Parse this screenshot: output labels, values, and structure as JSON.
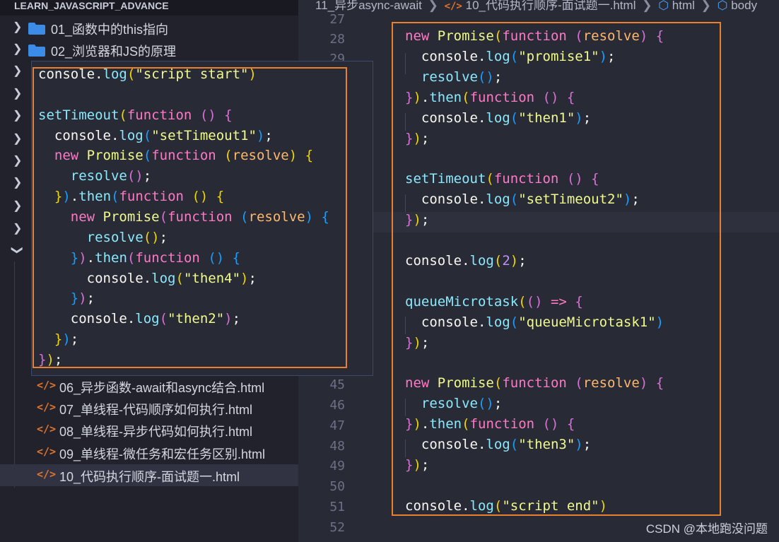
{
  "sidebar": {
    "header": "LEARN_JAVASCRIPT_ADVANCE",
    "folders": [
      {
        "label": "01_函数中的this指向"
      },
      {
        "label": "02_浏览器和JS的原理"
      }
    ],
    "files": [
      {
        "label": "06_异步函数-await和async结合.html"
      },
      {
        "label": "07_单线程-代码顺序如何执行.html"
      },
      {
        "label": "08_单线程-异步代码如何执行.html"
      },
      {
        "label": "09_单线程-微任务和宏任务区别.html"
      },
      {
        "label": "10_代码执行顺序-面试题一.html"
      }
    ],
    "file_icon": "html-tag-icon",
    "folder_icon": "folder-icon"
  },
  "breadcrumb": {
    "folder": "11_异步async-await",
    "file": "10_代码执行顺序-面试题一.html",
    "node1": "html",
    "node2": "body"
  },
  "gutter": {
    "lines": [
      "27",
      "28",
      "29",
      "45",
      "46",
      "47",
      "48",
      "49",
      "50",
      "51",
      "52"
    ]
  },
  "editor": {
    "lines": [
      "new Promise(function (resolve) {",
      "  console.log(\"promise1\");",
      "  resolve();",
      "}).then(function () {",
      "  console.log(\"then1\");",
      "});",
      "",
      "setTimeout(function () {",
      "  console.log(\"setTimeout2\");",
      "});",
      "",
      "console.log(2);",
      "",
      "queueMicrotask(() => {",
      "  console.log(\"queueMicrotask1\")",
      "});",
      "",
      "new Promise(function (resolve) {",
      "  resolve();",
      "}).then(function () {",
      "  console.log(\"then3\");",
      "});",
      "",
      "console.log(\"script end\")"
    ]
  },
  "popup": {
    "lines": [
      "console.log(\"script start\")",
      "",
      "setTimeout(function () {",
      "  console.log(\"setTimeout1\");",
      "  new Promise(function (resolve) {",
      "    resolve();",
      "  }).then(function () {",
      "    new Promise(function (resolve) {",
      "      resolve();",
      "    }).then(function () {",
      "      console.log(\"then4\");",
      "    });",
      "    console.log(\"then2\");",
      "  });",
      "});"
    ]
  },
  "watermark": "CSDN @本地跑没问题",
  "colors": {
    "accent_box": "#e8812f",
    "keyword": "#ff79c6",
    "string": "#f1fa8c",
    "function": "#8be9fd",
    "method": "#50fa7b"
  }
}
